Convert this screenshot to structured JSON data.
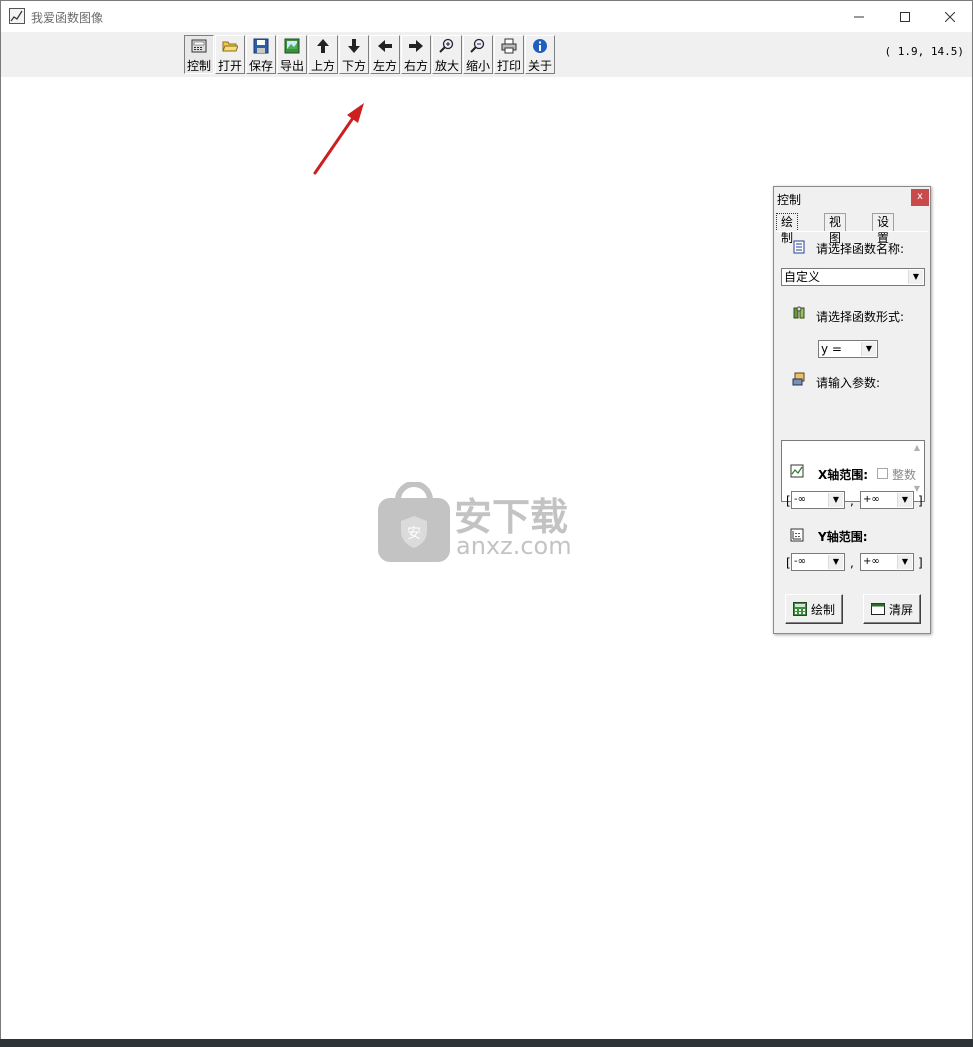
{
  "window": {
    "title": "我爱函数图像"
  },
  "toolbar": {
    "buttons": [
      {
        "label": "控制",
        "icon": "control-panel-icon"
      },
      {
        "label": "打开",
        "icon": "open-folder-icon"
      },
      {
        "label": "保存",
        "icon": "save-disk-icon"
      },
      {
        "label": "导出",
        "icon": "export-image-icon"
      },
      {
        "label": "上方",
        "icon": "arrow-up-icon"
      },
      {
        "label": "下方",
        "icon": "arrow-down-icon"
      },
      {
        "label": "左方",
        "icon": "arrow-left-icon"
      },
      {
        "label": "右方",
        "icon": "arrow-right-icon"
      },
      {
        "label": "放大",
        "icon": "zoom-in-icon"
      },
      {
        "label": "缩小",
        "icon": "zoom-out-icon"
      },
      {
        "label": "打印",
        "icon": "printer-icon"
      },
      {
        "label": "关于",
        "icon": "info-icon"
      }
    ],
    "coords": "( 1.9, 14.5)"
  },
  "panel": {
    "title": "控制",
    "close": "x",
    "tabs": [
      "绘制",
      "视图",
      "设置"
    ],
    "func_name_label": "请选择函数名称:",
    "func_name_value": "自定义",
    "func_form_label": "请选择函数形式:",
    "func_form_value": "y =",
    "params_label": "请输入参数:",
    "params_value": "",
    "x_range_label": "X轴范围:",
    "integer_label": "整数",
    "x_min": "-∞",
    "x_max": "+∞",
    "y_range_label": "Y轴范围:",
    "y_min": "-∞",
    "y_max": "+∞",
    "bracket_open": "[",
    "bracket_close": "]",
    "comma": ",",
    "draw_button": "绘制",
    "clear_button": "清屏"
  },
  "watermark": {
    "text_cn": "安下载",
    "text_en": "anxz.com"
  },
  "colors": {
    "arrow": "#cc1f1f",
    "close": "#c94a4a"
  }
}
